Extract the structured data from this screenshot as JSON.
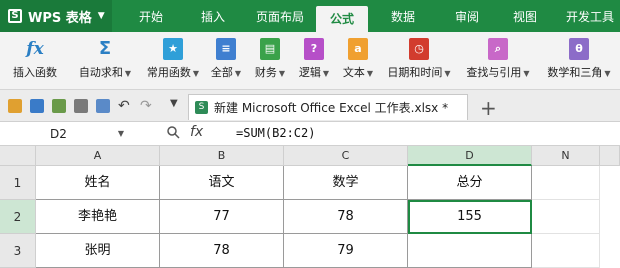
{
  "app": {
    "name": "WPS 表格"
  },
  "tabs": [
    "开始",
    "插入",
    "页面布局",
    "公式",
    "数据",
    "审阅",
    "视图",
    "开发工具"
  ],
  "active_tab": "公式",
  "ribbon": {
    "buttons": [
      "插入函数",
      "自动求和",
      "常用函数",
      "全部",
      "财务",
      "逻辑",
      "文本",
      "日期和时间",
      "查找与引用",
      "数学和三角"
    ]
  },
  "document": {
    "tab_title": "新建 Microsoft Office Excel 工作表.xlsx *"
  },
  "formula_bar": {
    "name_box": "D2",
    "formula": "=SUM(B2:C2)"
  },
  "grid": {
    "columns": [
      "A",
      "B",
      "C",
      "D",
      "N"
    ],
    "rows": [
      "1",
      "2",
      "3"
    ],
    "cells": [
      [
        "姓名",
        "语文",
        "数学",
        "总分",
        ""
      ],
      [
        "李艳艳",
        "77",
        "78",
        "155",
        ""
      ],
      [
        "张明",
        "78",
        "79",
        "",
        ""
      ]
    ],
    "selected": "D2"
  },
  "colors": {
    "accent": "#1f8a43"
  }
}
